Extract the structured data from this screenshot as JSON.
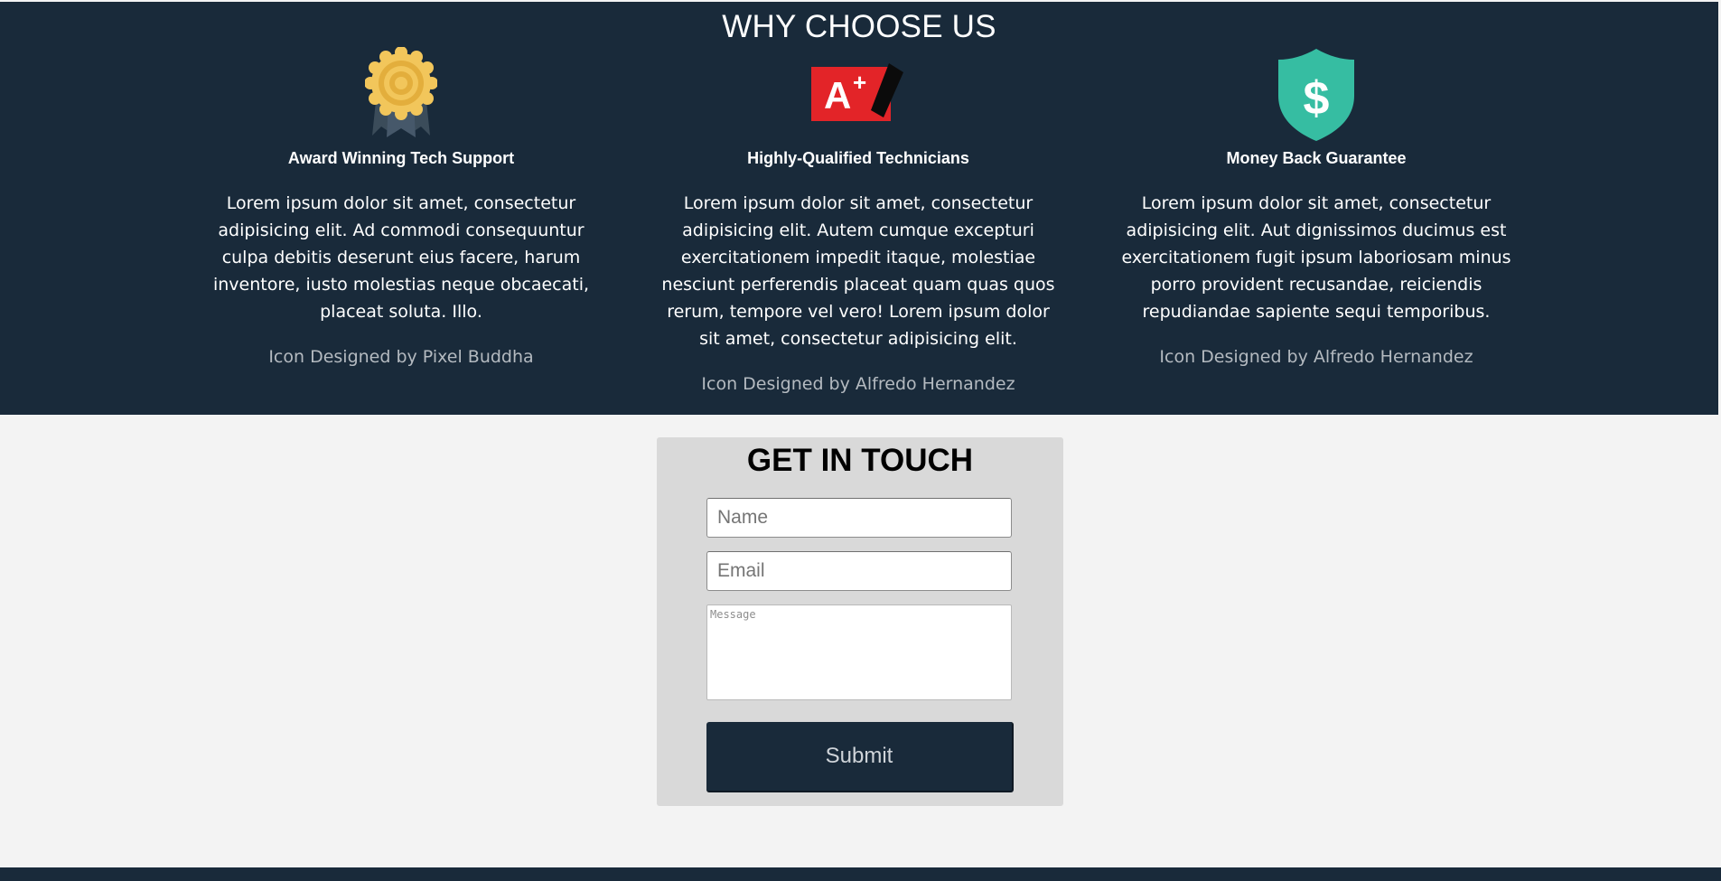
{
  "why_choose_us": {
    "title": "WHY CHOOSE US",
    "features": [
      {
        "icon": "award-medal-icon",
        "title": "Award Winning Tech Support",
        "text": "Lorem ipsum dolor sit amet, consectetur adipisicing elit. Ad commodi consequuntur culpa debitis deserunt eius facere, harum inventore, iusto molestias neque obcaecati, placeat soluta. Illo.",
        "credit": "Icon Designed by Pixel Buddha"
      },
      {
        "icon": "a-plus-grade-icon",
        "title": "Highly-Qualified Technicians",
        "text": "Lorem ipsum dolor sit amet, consectetur adipisicing elit. Autem cumque excepturi exercitationem impedit itaque, molestiae nesciunt perferendis placeat quam quas quos rerum, tempore vel vero! Lorem ipsum dolor sit amet, consectetur adipisicing elit.",
        "credit": "Icon Designed by Alfredo Hernandez"
      },
      {
        "icon": "dollar-shield-icon",
        "title": "Money Back Guarantee",
        "text": "Lorem ipsum dolor sit amet, consectetur adipisicing elit. Aut dignissimos ducimus est exercitationem fugit ipsum laboriosam minus porro provident recusandae, reiciendis repudiandae sapiente sequi temporibus.",
        "credit": "Icon Designed by Alfredo Hernandez"
      }
    ]
  },
  "contact": {
    "title": "GET IN TOUCH",
    "name_placeholder": "Name",
    "email_placeholder": "Email",
    "message_placeholder": "Message",
    "submit_label": "Submit"
  },
  "colors": {
    "dark_navy": "#192a3a",
    "page_background": "#f3f3f3",
    "form_panel": "#d9d9d9",
    "medal_gold": "#f2c65b",
    "grade_red": "#e32428",
    "shield_teal": "#36bda2"
  }
}
